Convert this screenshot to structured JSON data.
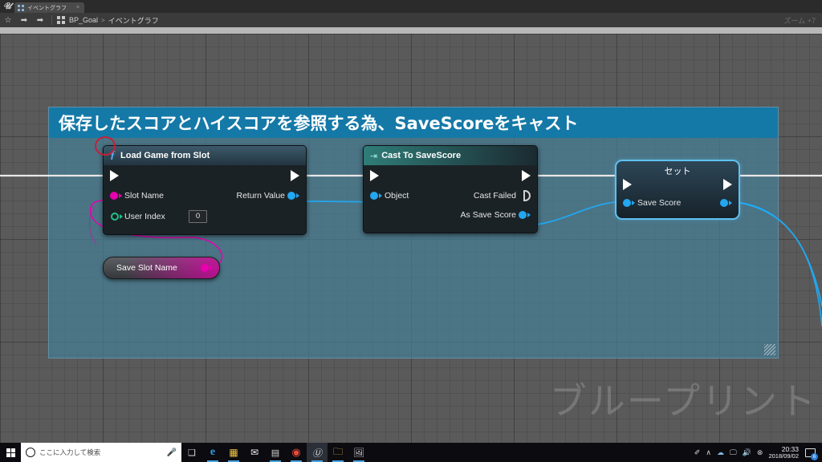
{
  "window": {
    "app_logo": "unreal-engine-logo",
    "tab_label": "イベントグラフ",
    "tab_close": "×"
  },
  "toolbar": {
    "favorite_icon": "star-icon",
    "back_icon": "back-arrow-icon",
    "forward_icon": "forward-arrow-icon",
    "breadcrumb_icon": "blueprint-icon",
    "breadcrumb_root": "BP_Goal",
    "breadcrumb_sep": ">",
    "breadcrumb_leaf": "イベントグラフ",
    "zoom_label": "ズーム +7"
  },
  "canvas": {
    "watermark": "ブループリント",
    "comment": {
      "title": "保存したスコアとハイスコアを参照する為、SaveScoreをキャスト",
      "header_color": "#1579a8",
      "body_color": "#457e96"
    },
    "annotation": {
      "name": "red-circle-highlight",
      "color": "#c5203a"
    }
  },
  "nodes": {
    "load_game": {
      "title": "Load Game from Slot",
      "glyph": "ƒ",
      "inputs": [
        {
          "label": "Slot Name",
          "pin_color": "#e800b0",
          "pin_type": "string"
        },
        {
          "label": "User Index",
          "pin_color": "#21c08a",
          "pin_type": "int",
          "value": "0"
        }
      ],
      "outputs": [
        {
          "label": "Return Value",
          "pin_color": "#22a7f0",
          "pin_type": "object"
        }
      ]
    },
    "cast_node": {
      "title": "Cast To SaveScore",
      "glyph": "⇥",
      "inputs": [
        {
          "label": "Object",
          "pin_color": "#22a7f0",
          "pin_type": "object"
        }
      ],
      "outputs": [
        {
          "label": "Cast Failed",
          "pin_color": "#cfcfcf",
          "pin_type": "exec"
        },
        {
          "label": "As Save Score",
          "pin_color": "#22a7f0",
          "pin_type": "object"
        }
      ]
    },
    "set_node": {
      "title": "セット",
      "selected": true,
      "inputs": [
        {
          "label": "Save Score",
          "pin_color": "#22a7f0",
          "pin_type": "object"
        }
      ],
      "outputs": [
        {
          "label": "",
          "pin_color": "#22a7f0",
          "pin_type": "object"
        }
      ]
    },
    "getter_node": {
      "title": "Save Slot Name",
      "pin_color": "#e800b0",
      "pin_type": "string"
    }
  },
  "taskbar": {
    "start_icon": "windows-start-icon",
    "search_placeholder": "ここに入力して検索",
    "search_icon": "search-circle-icon",
    "mic_icon": "microphone-icon",
    "apps": [
      {
        "name": "task-view-icon",
        "glyph": "❐"
      },
      {
        "name": "edge-browser-icon",
        "glyph": "e"
      },
      {
        "name": "microsoft-store-icon",
        "glyph": "🛍"
      },
      {
        "name": "mail-icon",
        "glyph": "✉"
      },
      {
        "name": "calculator-icon",
        "glyph": "▤"
      },
      {
        "name": "chrome-icon",
        "glyph": "◉"
      },
      {
        "name": "unreal-engine-icon",
        "glyph": "U"
      },
      {
        "name": "file-explorer-icon",
        "glyph": "🗀"
      },
      {
        "name": "photos-icon",
        "glyph": "🖼"
      }
    ],
    "tray": [
      {
        "name": "pen-tray-icon",
        "glyph": "✐"
      },
      {
        "name": "show-hidden-icons-icon",
        "glyph": "∧"
      },
      {
        "name": "cloud-icon",
        "glyph": "☁"
      },
      {
        "name": "network-icon",
        "glyph": "🖵"
      },
      {
        "name": "volume-icon",
        "glyph": "◀"
      },
      {
        "name": "onedrive-status-icon",
        "glyph": "⊗"
      }
    ],
    "clock_time": "20:33",
    "clock_date": "2018/09/02",
    "notification_count": "6"
  }
}
